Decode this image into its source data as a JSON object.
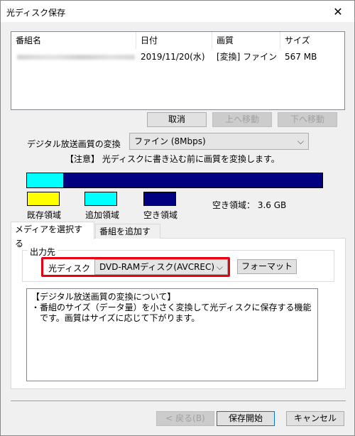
{
  "window": {
    "title": "光ディスク保存",
    "close_glyph": "✕"
  },
  "list": {
    "columns": [
      "番組名",
      "日付",
      "画質",
      "サイズ"
    ],
    "rows": [
      {
        "title": "",
        "date": "2019/11/20(水)",
        "quality": "[変換] ファイン",
        "size": "567 MB"
      }
    ]
  },
  "buttons": {
    "cancel": "取消",
    "move_up": "上へ移動",
    "move_down": "下へ移動",
    "format": "フォーマット",
    "back": "< 戻る(B)",
    "start_save": "保存開始",
    "cancel_dialog": "キャンセル"
  },
  "conversion": {
    "label": "デジタル放送画質の変換",
    "selected": "ファイン (8Mbps)",
    "note": "【注意】 光ディスクに書き込む前に画質を変換します。"
  },
  "capacity": {
    "used_fraction": 0.125,
    "legend": [
      {
        "label": "既存領域",
        "color": "#ffff00"
      },
      {
        "label": "追加領域",
        "color": "#00ffff"
      },
      {
        "label": "空き領域",
        "color": "#000080"
      }
    ],
    "free_space": "空き領域： 3.6 GB"
  },
  "tabs": [
    {
      "label": "メディアを選択する",
      "active": true
    },
    {
      "label": "番組を追加する",
      "active": false
    }
  ],
  "output": {
    "group_title": "出力先",
    "label": "光ディスク",
    "selected": "DVD-RAMディスク(AVCREC)"
  },
  "info": {
    "lines": [
      "【デジタル放送画質の変換について】",
      "・番組のサイズ（データ量）を小さく変換して光ディスクに保存する機能",
      "　です。画質はサイズに応じて下がります。"
    ]
  }
}
